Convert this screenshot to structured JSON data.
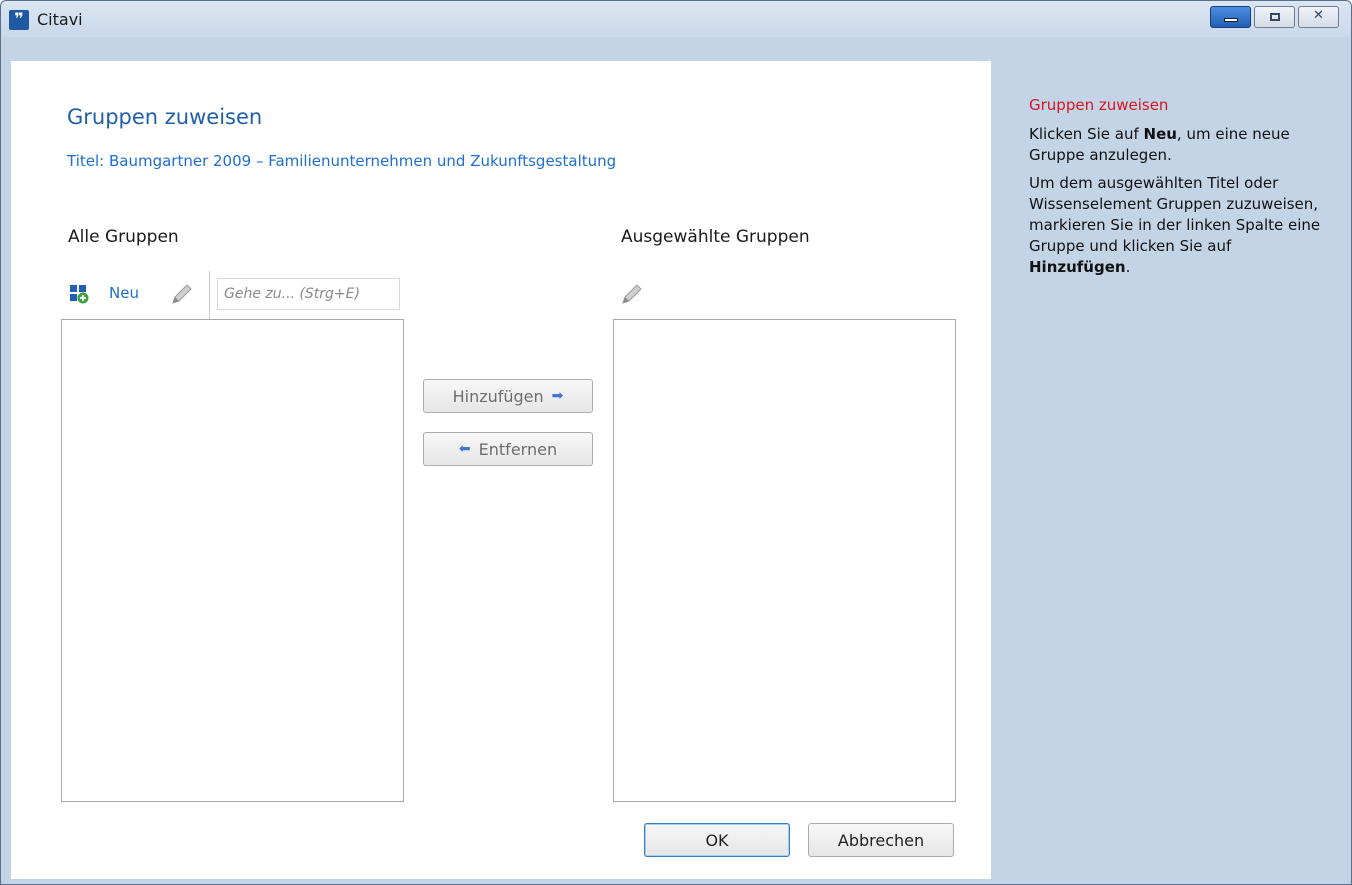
{
  "window": {
    "app_title": "Citavi",
    "app_icon_glyph": "9",
    "controls": [
      "minimize-icon",
      "maximize-icon",
      "close-icon"
    ]
  },
  "dialog": {
    "title": "Gruppen zuweisen",
    "subtitle": "Titel: Baumgartner 2009 – Familienunternehmen und Zukunftsgestaltung"
  },
  "left": {
    "heading": "Alle Gruppen",
    "new_label": "Neu",
    "new_icon": "add-group-icon",
    "edit_icon": "pencil-icon",
    "search_placeholder": "Gehe zu... (Strg+E)",
    "items": []
  },
  "right": {
    "heading": "Ausgewählte Gruppen",
    "edit_icon": "pencil-icon",
    "items": []
  },
  "transfer": {
    "add_label": "Hinzufügen",
    "add_arrow": "➡",
    "remove_label": "Entfernen",
    "remove_arrow": "⬅"
  },
  "footer": {
    "ok_label": "OK",
    "cancel_label": "Abbrechen"
  },
  "help": {
    "title": "Gruppen zuweisen",
    "p1_pre": "Klicken Sie auf ",
    "p1_bold": "Neu",
    "p1_post": ", um eine neue Gruppe anzulegen.",
    "p2_pre": "Um dem ausgewählten Titel oder Wissenselement Gruppen zuzuweisen, markieren Sie in der linken Spalte eine Gruppe und klicken Sie auf ",
    "p2_bold": "Hinzufügen",
    "p2_post": "."
  },
  "colors": {
    "title_blue": "#1f5fa8",
    "link_blue": "#1d6fd0",
    "help_red": "#d9141d",
    "panel_bg": "#c4d4e7"
  }
}
